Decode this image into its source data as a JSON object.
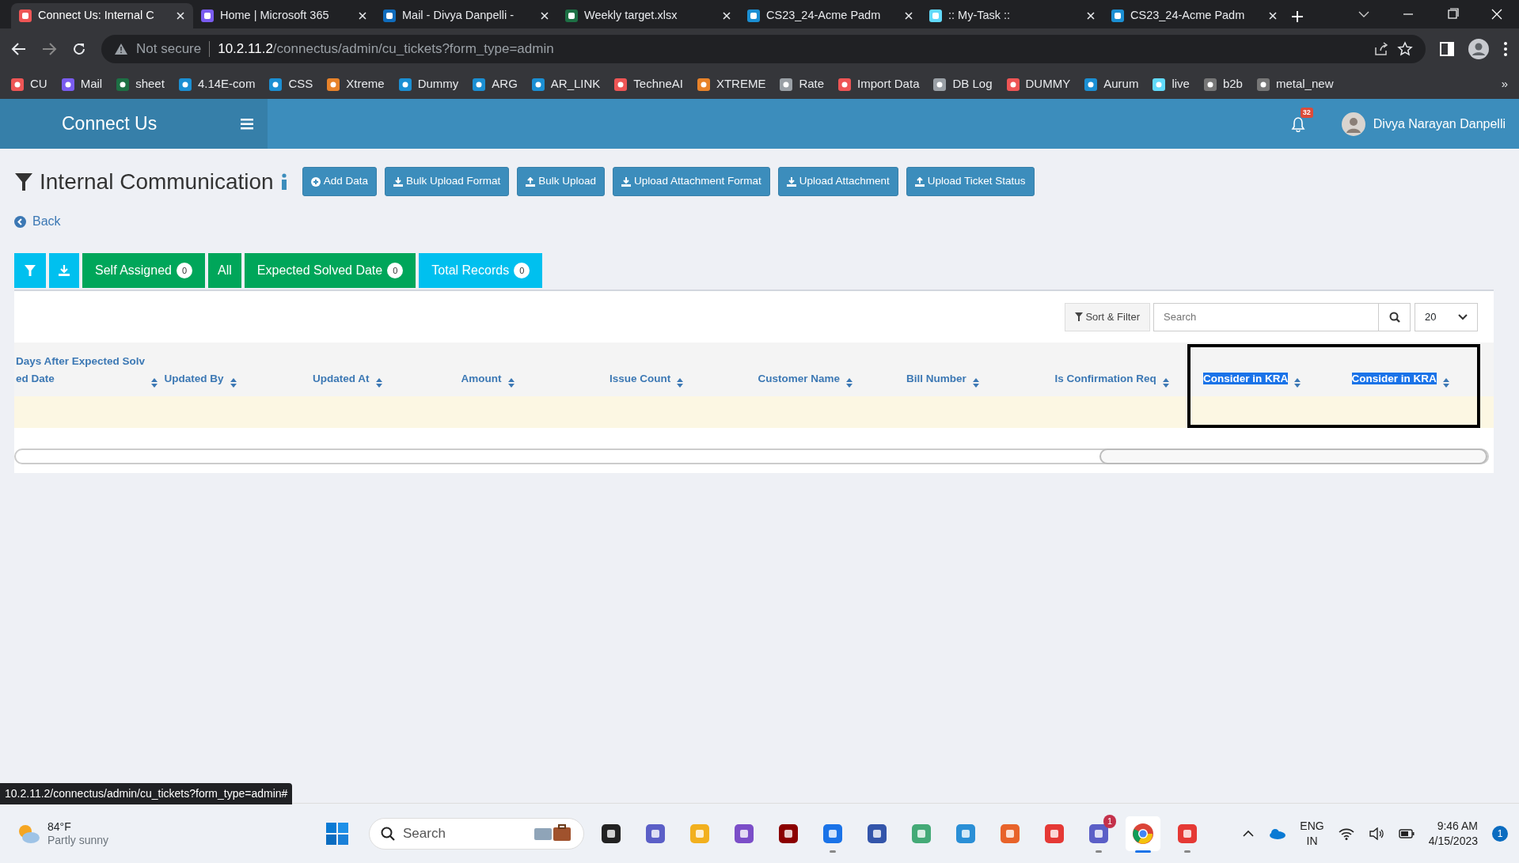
{
  "browser": {
    "tabs": [
      {
        "title": "Connect Us: Internal C",
        "selected": true
      },
      {
        "title": "Home | Microsoft 365",
        "selected": false
      },
      {
        "title": "Mail - Divya Danpelli -",
        "selected": false
      },
      {
        "title": "Weekly target.xlsx",
        "selected": false
      },
      {
        "title": "CS23_24-Acme Padm",
        "selected": false
      },
      {
        "title": ":: My-Task ::",
        "selected": false
      },
      {
        "title": "CS23_24-Acme Padm",
        "selected": false
      }
    ],
    "address": {
      "security": "Not secure",
      "host": "10.2.11.2",
      "path": "/connectus/admin/cu_tickets?form_type=admin"
    },
    "bookmarks": [
      {
        "label": "CU"
      },
      {
        "label": "Mail"
      },
      {
        "label": "sheet"
      },
      {
        "label": "4.14E-com"
      },
      {
        "label": "CSS"
      },
      {
        "label": "Xtreme"
      },
      {
        "label": "Dummy"
      },
      {
        "label": "ARG"
      },
      {
        "label": "AR_LINK"
      },
      {
        "label": "TechneAI"
      },
      {
        "label": "XTREME"
      },
      {
        "label": "Rate"
      },
      {
        "label": "Import Data"
      },
      {
        "label": "DB Log"
      },
      {
        "label": "DUMMY"
      },
      {
        "label": "Aurum"
      },
      {
        "label": "live"
      },
      {
        "label": "b2b"
      },
      {
        "label": "metal_new"
      }
    ],
    "bookmarks_overflow": "»"
  },
  "app": {
    "brand": "Connect Us",
    "notifications": "32",
    "user": "Divya Narayan Danpelli",
    "page_title": "Internal Communication",
    "action_buttons": [
      {
        "label": "Add Data",
        "kind": "add"
      },
      {
        "label": "Bulk Upload Format",
        "kind": "download"
      },
      {
        "label": "Bulk Upload",
        "kind": "upload"
      },
      {
        "label": "Upload Attachment Format",
        "kind": "download"
      },
      {
        "label": "Upload Attachment",
        "kind": "download"
      },
      {
        "label": "Upload Ticket Status",
        "kind": "upload"
      }
    ],
    "back": "Back",
    "filter_tabs": [
      {
        "kind": "filter",
        "color": "#00c0ef"
      },
      {
        "kind": "download",
        "color": "#00c0ef"
      },
      {
        "kind": "count",
        "label": "Self Assigned",
        "count": "0",
        "color": "#00a65a"
      },
      {
        "kind": "text",
        "label": "All",
        "color": "#00a65a"
      },
      {
        "kind": "count",
        "label": "Expected Solved Date",
        "count": "0",
        "color": "#00a65a"
      },
      {
        "kind": "count",
        "label": "Total Records",
        "count": "0",
        "color": "#00c0ef"
      }
    ],
    "toolbar": {
      "sort_filter": "Sort & Filter",
      "search": {
        "placeholder": "Search"
      },
      "page_size": "20"
    },
    "table": {
      "columns": [
        {
          "lines": [
            "Days After Expected Solv",
            "ed Date"
          ],
          "text_selected": false
        },
        {
          "lines": [
            "Updated By"
          ],
          "text_selected": false
        },
        {
          "lines": [
            "Updated At"
          ],
          "text_selected": false
        },
        {
          "lines": [
            "Amount"
          ],
          "text_selected": false
        },
        {
          "lines": [
            "Issue Count"
          ],
          "text_selected": false
        },
        {
          "lines": [
            "Customer Name"
          ],
          "text_selected": false
        },
        {
          "lines": [
            "Bill Number"
          ],
          "text_selected": false
        },
        {
          "lines": [
            "Is Confirmation Req"
          ],
          "text_selected": false
        },
        {
          "lines": [
            "Consider in KRA"
          ],
          "text_selected": true
        },
        {
          "lines": [
            "Consider in KRA"
          ],
          "text_selected": true
        }
      ]
    }
  },
  "status_url": "10.2.11.2/connectus/admin/cu_tickets?form_type=admin#",
  "taskbar": {
    "weather": {
      "temperature": "84°F",
      "condition": "Partly sunny"
    },
    "search": {
      "placeholder": "Search"
    },
    "apps": [
      {
        "running": false,
        "selected": false
      },
      {
        "running": false,
        "selected": false
      },
      {
        "running": false,
        "selected": false
      },
      {
        "running": false,
        "selected": false
      },
      {
        "running": false,
        "selected": false
      },
      {
        "running": true,
        "selected": false
      },
      {
        "running": false,
        "selected": false
      },
      {
        "running": false,
        "selected": false
      },
      {
        "running": false,
        "selected": false
      },
      {
        "running": false,
        "selected": false
      },
      {
        "running": false,
        "selected": false
      },
      {
        "running": true,
        "selected": false,
        "badge": "1"
      },
      {
        "running": true,
        "selected": true
      },
      {
        "running": true,
        "selected": false
      }
    ],
    "language": [
      "ENG",
      "IN"
    ],
    "time": "9:46 AM",
    "date": "4/15/2023",
    "notifications": "1"
  }
}
